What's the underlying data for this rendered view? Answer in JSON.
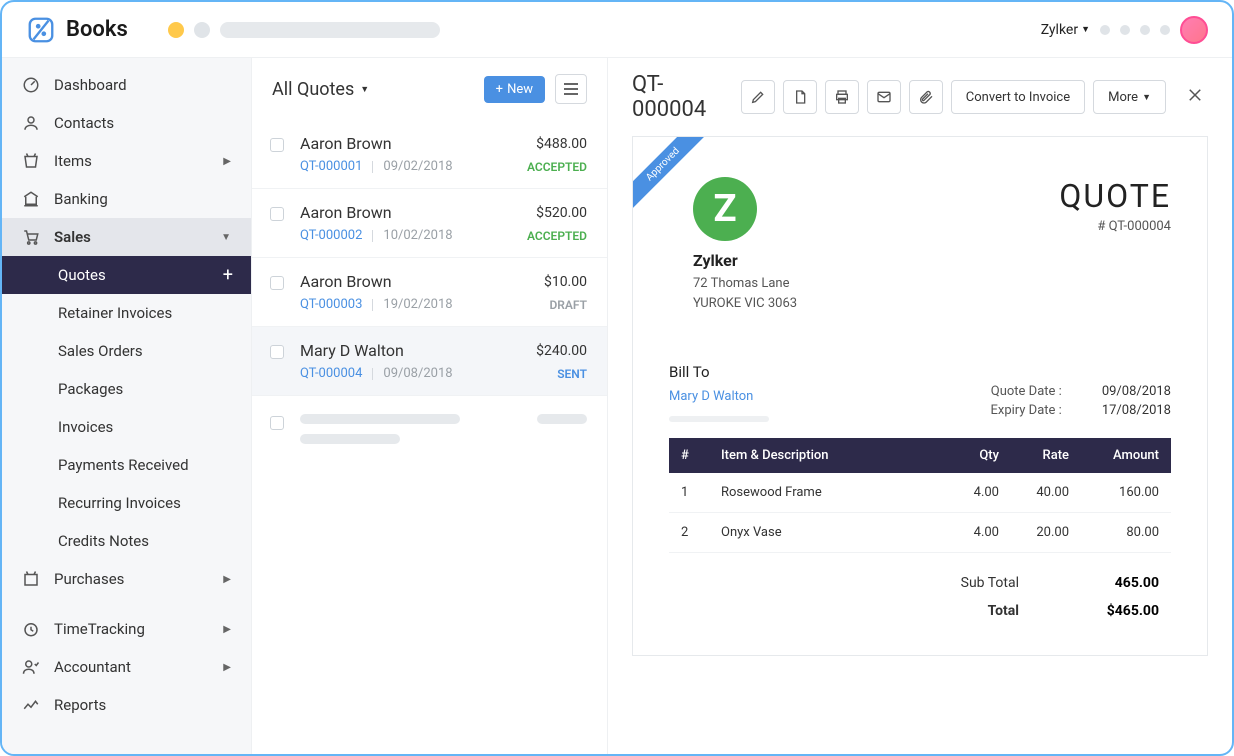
{
  "app_name": "Books",
  "account_name": "Zylker",
  "nav": {
    "dashboard": "Dashboard",
    "contacts": "Contacts",
    "items": "Items",
    "banking": "Banking",
    "sales": "Sales",
    "purchases": "Purchases",
    "timetracking": "TimeTracking",
    "accountant": "Accountant",
    "reports": "Reports"
  },
  "sales_sub": {
    "quotes": "Quotes",
    "retainer": "Retainer Invoices",
    "sales_orders": "Sales Orders",
    "packages": "Packages",
    "invoices": "Invoices",
    "payments": "Payments Received",
    "recurring": "Recurring Invoices",
    "credits": "Credits Notes"
  },
  "list": {
    "title": "All Quotes",
    "new_label": "New",
    "rows": [
      {
        "customer": "Aaron Brown",
        "amount": "$488.00",
        "qnum": "QT-000001",
        "date": "09/02/2018",
        "status": "ACCEPTED",
        "status_class": "accepted"
      },
      {
        "customer": "Aaron Brown",
        "amount": "$520.00",
        "qnum": "QT-000002",
        "date": "10/02/2018",
        "status": "ACCEPTED",
        "status_class": "accepted"
      },
      {
        "customer": "Aaron Brown",
        "amount": "$10.00",
        "qnum": "QT-000003",
        "date": "19/02/2018",
        "status": "DRAFT",
        "status_class": "draft"
      },
      {
        "customer": "Mary D Walton",
        "amount": "$240.00",
        "qnum": "QT-000004",
        "date": "09/08/2018",
        "status": "SENT",
        "status_class": "sent"
      }
    ]
  },
  "detail": {
    "title": "QT-000004",
    "convert_label": "Convert to Invoice",
    "more_label": "More",
    "ribbon": "Approved",
    "company": {
      "logo_letter": "Z",
      "name": "Zylker",
      "addr1": "72 Thomas Lane",
      "addr2": "YUROKE VIC 3063"
    },
    "doc_label": "QUOTE",
    "doc_num": "# QT-000004",
    "bill_to_label": "Bill To",
    "bill_to_name": "Mary D Walton",
    "quote_date_label": "Quote Date :",
    "quote_date": "09/08/2018",
    "expiry_date_label": "Expiry Date :",
    "expiry_date": "17/08/2018",
    "cols": {
      "num": "#",
      "item": "Item & Description",
      "qty": "Qty",
      "rate": "Rate",
      "amount": "Amount"
    },
    "items": [
      {
        "n": "1",
        "desc": "Rosewood Frame",
        "qty": "4.00",
        "rate": "40.00",
        "amount": "160.00"
      },
      {
        "n": "2",
        "desc": "Onyx Vase",
        "qty": "4.00",
        "rate": "20.00",
        "amount": "80.00"
      }
    ],
    "subtotal_label": "Sub Total",
    "subtotal": "465.00",
    "total_label": "Total",
    "total": "$465.00"
  }
}
